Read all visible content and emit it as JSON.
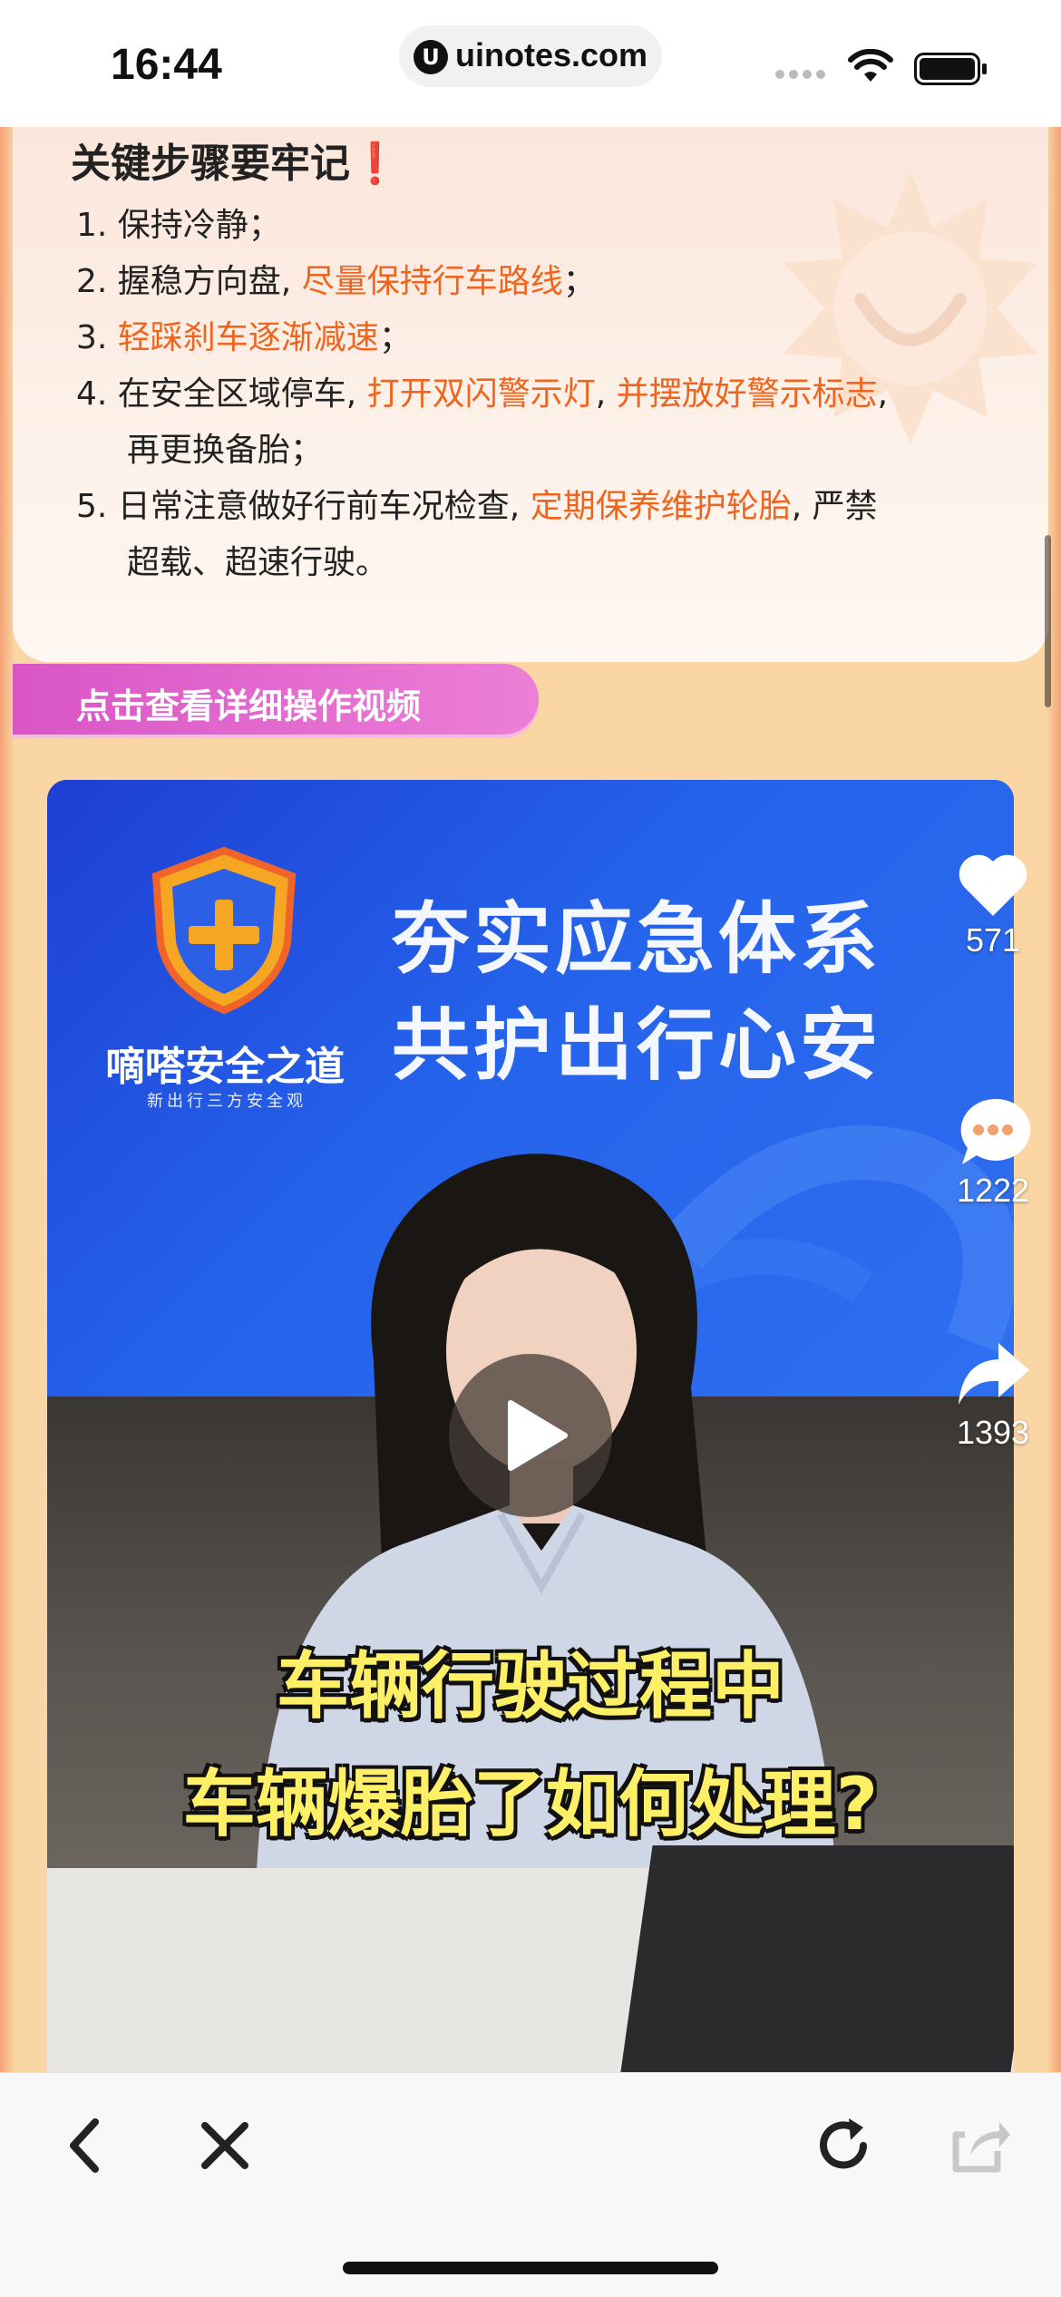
{
  "status_bar": {
    "time": "16:44",
    "url": "uinotes.com"
  },
  "card": {
    "heading": "关键步骤要牢记",
    "heading_mark": "❗",
    "steps": [
      {
        "num": "1. ",
        "plain1": "保持冷静；"
      },
      {
        "num": "2. ",
        "plain1": "握稳方向盘, ",
        "hl1": "尽量保持行车路线",
        "plain2": "；"
      },
      {
        "num": "3. ",
        "hl1": "轻踩刹车逐渐减速",
        "plain2": "；"
      },
      {
        "num": "4. ",
        "plain1": "在安全区域停车, ",
        "hl1": "打开双闪警示灯",
        "plain2": ", ",
        "hl2": "并摆放好警示标志",
        "plain3": ",",
        "cont": "再更换备胎；"
      },
      {
        "num": "5. ",
        "plain1": "日常注意做好行前车况检查, ",
        "hl1": "定期保养维护轮胎",
        "plain2": ", 严禁",
        "cont": "超载、超速行驶。"
      }
    ]
  },
  "video_button_label": "点击查看详细操作视频",
  "video": {
    "brand_name": "嘀嗒安全之道",
    "brand_sub": "新出行三方安全观",
    "title_line1": "夯实应急体系",
    "title_line2": "共护出行心安",
    "caption_line1": "车辆行驶过程中",
    "caption_line2": "车辆爆胎了如何处理?",
    "actions": {
      "likes": "571",
      "comments": "1222",
      "shares": "1393"
    }
  },
  "colors": {
    "highlight": "#f0651d",
    "video_button": "#e06bcf",
    "caption": "#fdf066"
  }
}
